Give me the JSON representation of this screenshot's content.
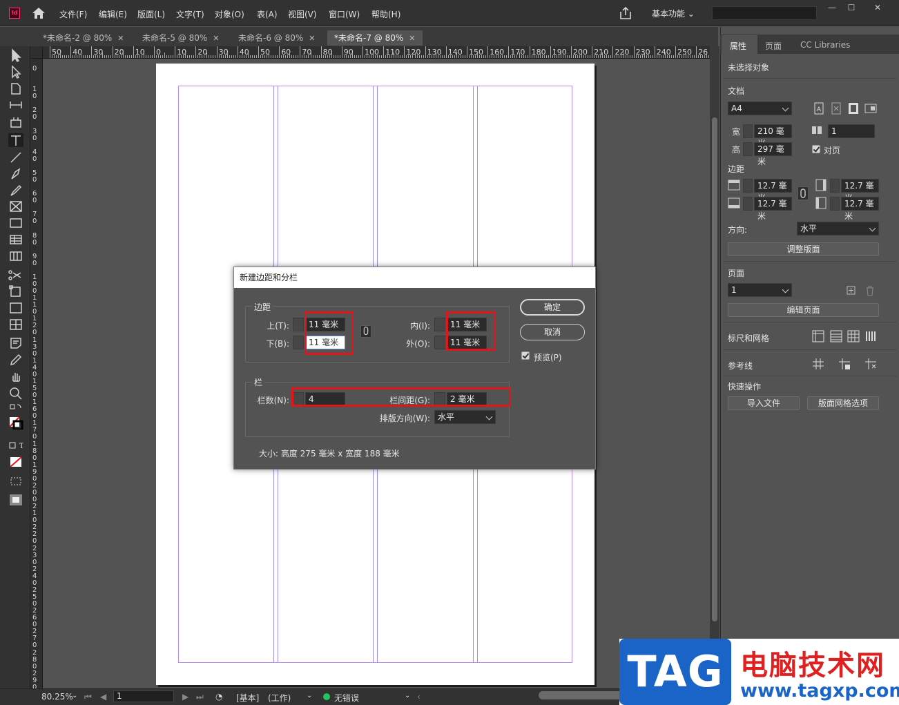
{
  "app": {
    "logo_text": "Id",
    "menus": [
      "文件(F)",
      "编辑(E)",
      "版面(L)",
      "文字(T)",
      "对象(O)",
      "表(A)",
      "视图(V)",
      "窗口(W)",
      "帮助(H)"
    ],
    "workspace": "基本功能",
    "window_controls": [
      "—",
      "☐",
      "✕"
    ]
  },
  "doc_tabs": [
    {
      "label": "*未命名-2 @ 80%",
      "active": false
    },
    {
      "label": "未命名-5 @ 80%",
      "active": false
    },
    {
      "label": "未命名-6 @ 80%",
      "active": false
    },
    {
      "label": "*未命名-7 @ 80%",
      "active": true
    }
  ],
  "tab_close": "✕",
  "ruler": {
    "h_labels": [
      "50",
      "40",
      "30",
      "20",
      "10",
      "0",
      "10",
      "20",
      "30",
      "40",
      "50",
      "60",
      "70",
      "80",
      "90",
      "100",
      "110",
      "120",
      "130",
      "140",
      "150",
      "160",
      "170",
      "180",
      "190",
      "200",
      "210",
      "220",
      "230",
      "240",
      "250",
      "26"
    ],
    "v_labels": [
      "0",
      "10",
      "20",
      "30",
      "40",
      "50",
      "60",
      "70",
      "80",
      "90",
      "100",
      "110",
      "120",
      "130",
      "140",
      "150",
      "160",
      "170",
      "180",
      "190",
      "200",
      "210",
      "220",
      "230",
      "240",
      "250",
      "260",
      "270",
      "280",
      "290"
    ]
  },
  "tools": [
    "selection-tool-icon",
    "direct-selection-tool-icon",
    "page-tool-icon",
    "gap-tool-icon",
    "content-collector-icon",
    "type-tool-icon",
    "line-tool-icon",
    "pen-tool-icon",
    "pencil-tool-icon",
    "rectangle-frame-tool-icon",
    "rectangle-tool-icon",
    "table-tool-icon",
    "grid-tool-icon",
    "scissors-tool-icon",
    "free-transform-tool-icon",
    "gradient-swatch-tool-icon",
    "gradient-feather-tool-icon",
    "note-tool-icon",
    "eyedropper-tool-icon",
    "hand-tool-icon",
    "zoom-tool-icon"
  ],
  "status": {
    "zoom": "80.25%",
    "page": "1",
    "style": "[基本]",
    "mode": "(工作)",
    "preflight": "无错误",
    "preflight_color": "#22c55e"
  },
  "right_panel": {
    "tabs": [
      "属性",
      "页面",
      "CC Libraries"
    ],
    "no_selection": "未选择对象",
    "document": {
      "title": "文档",
      "size": "A4",
      "width_label": "宽",
      "width": "210 毫米",
      "height_label": "高",
      "height": "297 毫米",
      "pages": "1",
      "facing_label": "对页",
      "facing_checked": true
    },
    "margins": {
      "title": "边距",
      "top": "12.7 毫米",
      "bottom": "12.7 毫米",
      "inside": "12.7 毫米",
      "outside": "12.7 毫米"
    },
    "orientation_label": "方向:",
    "orientation": "水平",
    "adjust_layout": "调整版面",
    "pages_section": {
      "title": "页面",
      "page": "1",
      "edit_page": "编辑页面"
    },
    "rulers_grids": "标尺和网格",
    "guides": "参考线",
    "quick_actions": {
      "title": "快速操作",
      "import_file": "导入文件",
      "layout_grid": "版面网格选项"
    }
  },
  "dialog": {
    "title": "新建边距和分栏",
    "margins_group": "边距",
    "top_label": "上(T):",
    "top": "11 毫米",
    "bottom_label": "下(B):",
    "bottom": "11 毫米",
    "inside_label": "内(I):",
    "inside": "11 毫米",
    "outside_label": "外(O):",
    "outside": "11 毫米",
    "columns_group": "栏",
    "columns_label": "栏数(N):",
    "columns": "4",
    "gutter_label": "栏间距(G):",
    "gutter": "2 毫米",
    "direction_label": "排版方向(W):",
    "direction": "水平",
    "ok": "确定",
    "cancel": "取消",
    "preview_label": "预览(P)",
    "preview_checked": true,
    "size_info": "大小: 高度 275 毫米 x 宽度 188 毫米",
    "highlight_color": "#e0161b"
  },
  "watermark": {
    "tag": "TAG",
    "site_name": "电脑技术网",
    "url": "www.tagxp.com"
  }
}
